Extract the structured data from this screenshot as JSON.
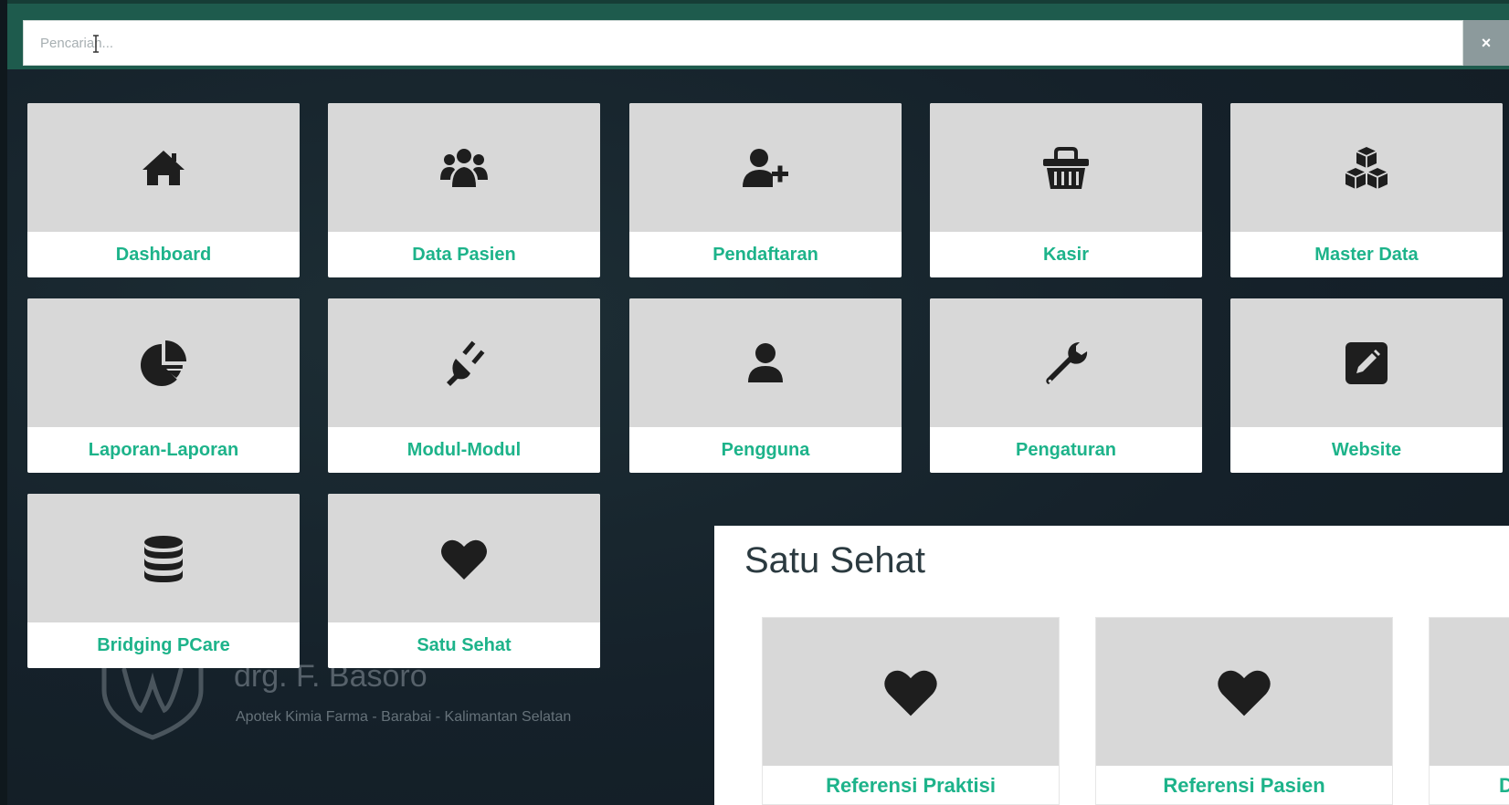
{
  "search": {
    "placeholder": "Pencarian..."
  },
  "close_label": "×",
  "menu": [
    {
      "label": "Dashboard",
      "icon": "home-icon"
    },
    {
      "label": "Data Pasien",
      "icon": "users-icon"
    },
    {
      "label": "Pendaftaran",
      "icon": "user-plus-icon"
    },
    {
      "label": "Kasir",
      "icon": "basket-icon"
    },
    {
      "label": "Master Data",
      "icon": "cubes-icon"
    },
    {
      "label": "Laporan-Laporan",
      "icon": "pie-chart-icon"
    },
    {
      "label": "Modul-Modul",
      "icon": "plug-icon"
    },
    {
      "label": "Pengguna",
      "icon": "user-icon"
    },
    {
      "label": "Pengaturan",
      "icon": "wrench-icon"
    },
    {
      "label": "Website",
      "icon": "edit-icon"
    },
    {
      "label": "Bridging PCare",
      "icon": "database-icon"
    },
    {
      "label": "Satu Sehat",
      "icon": "heart-icon"
    }
  ],
  "watermark": {
    "name": "drg. F. Basoro",
    "subtitle": "Apotek Kimia Farma - Barabai - Kalimantan Selatan"
  },
  "panel": {
    "title": "Satu Sehat",
    "items": [
      {
        "label": "Referensi Praktisi",
        "icon": "heart-icon"
      },
      {
        "label": "Referensi Pasien",
        "icon": "heart-icon"
      },
      {
        "label": "D",
        "icon": "heart-icon"
      }
    ]
  },
  "colors": {
    "accent": "#1db38a",
    "top_bar": "#1e5b4d",
    "background": "#16232a",
    "tile_icon_bg": "#d8d8d8",
    "icon": "#1e1e1e"
  }
}
